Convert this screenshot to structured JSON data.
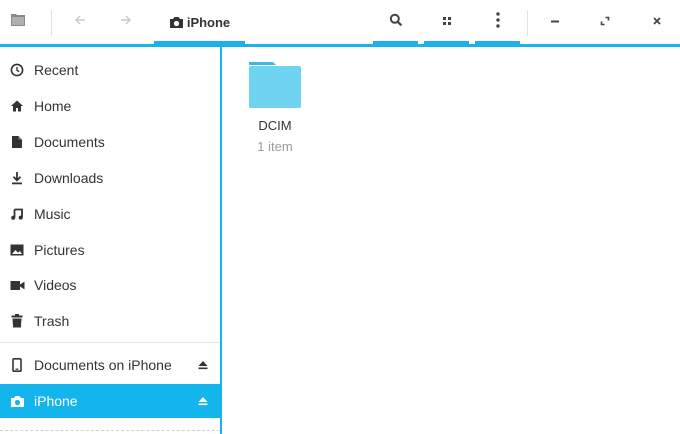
{
  "header": {
    "path_label": "iPhone",
    "icons": {
      "sidebar_toggle": "sidebar-toggle-icon",
      "back": "arrow-left-icon",
      "forward": "arrow-right-icon",
      "location": "camera-icon",
      "search": "search-icon",
      "view": "grid-view-icon",
      "menu": "more-vertical-icon",
      "minimize": "minimize-icon",
      "maximize": "maximize-icon",
      "close": "close-icon"
    }
  },
  "sidebar": {
    "items": [
      {
        "label": "Recent",
        "icon": "clock-icon"
      },
      {
        "label": "Home",
        "icon": "home-icon"
      },
      {
        "label": "Documents",
        "icon": "document-icon"
      },
      {
        "label": "Downloads",
        "icon": "download-icon"
      },
      {
        "label": "Music",
        "icon": "music-icon"
      },
      {
        "label": "Pictures",
        "icon": "picture-icon"
      },
      {
        "label": "Videos",
        "icon": "video-icon"
      },
      {
        "label": "Trash",
        "icon": "trash-icon"
      }
    ],
    "devices": [
      {
        "label": "Documents on iPhone",
        "icon": "phone-icon",
        "eject": "eject-icon"
      },
      {
        "label": "iPhone",
        "icon": "camera-icon",
        "eject": "eject-icon",
        "active": true
      }
    ]
  },
  "main": {
    "items": [
      {
        "name": "DCIM",
        "subtitle": "1 item",
        "icon": "folder-icon"
      }
    ]
  },
  "colors": {
    "accent": "#1ab2e8",
    "selected_bg": "#14b4ec",
    "folder": "#6fd3f2",
    "folder_tab": "#3db7e6"
  }
}
